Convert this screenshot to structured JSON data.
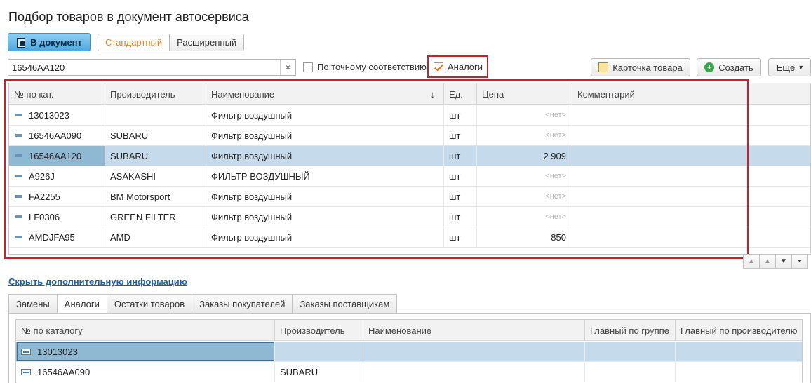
{
  "title": "Подбор товаров в документ автосервиса",
  "toolbar": {
    "to_document": "В документ",
    "mode_standard": "Стандартный",
    "mode_extended": "Расширенный",
    "card_button": "Карточка товара",
    "create_button": "Создать",
    "more_button": "Еще",
    "more_arrow": "▾"
  },
  "search": {
    "value": "16546AA120",
    "clear_symbol": "×"
  },
  "filters": {
    "exact_match": "По точному соответствию",
    "analogs": "Аналоги"
  },
  "main_table": {
    "columns": [
      "№ по кат.",
      "Производитель",
      "Наименование",
      "Ед.",
      "Цена",
      "Комментарий"
    ],
    "sort_indicator": "↓",
    "rows": [
      {
        "code": "13013023",
        "maker": "",
        "name": "Фильтр воздушный",
        "unit": "шт",
        "price": "<нет>",
        "comment": ""
      },
      {
        "code": "16546AA090",
        "maker": "SUBARU",
        "name": "Фильтр воздушный",
        "unit": "шт",
        "price": "<нет>",
        "comment": ""
      },
      {
        "code": "16546AA120",
        "maker": "SUBARU",
        "name": "Фильтр воздушный",
        "unit": "шт",
        "price": "2 909",
        "comment": ""
      },
      {
        "code": "A926J",
        "maker": "ASAKASHI",
        "name": "ФИЛЬТР ВОЗДУШНЫЙ",
        "unit": "шт",
        "price": "<нет>",
        "comment": ""
      },
      {
        "code": "FA2255",
        "maker": "BM Motorsport",
        "name": "Фильтр воздушный",
        "unit": "шт",
        "price": "<нет>",
        "comment": ""
      },
      {
        "code": "LF0306",
        "maker": "GREEN FILTER",
        "name": "Фильтр воздушный",
        "unit": "шт",
        "price": "<нет>",
        "comment": ""
      },
      {
        "code": "AMDJFA95",
        "maker": "AMD",
        "name": "Фильтр воздушный",
        "unit": "шт",
        "price": "850",
        "comment": ""
      }
    ],
    "selected_row": 2
  },
  "nav": {
    "up": "▲",
    "up2": "▲",
    "down": "▼",
    "last": "⏷"
  },
  "hide_info_link": "Скрыть дополнительную информацию",
  "tabs": [
    "Замены",
    "Аналоги",
    "Остатки товаров",
    "Заказы покупателей",
    "Заказы поставщикам"
  ],
  "active_tab": 1,
  "analog_table": {
    "columns": [
      "№ по каталогу",
      "Производитель",
      "Наименование",
      "Главный по группе",
      "Главный по производителю"
    ],
    "rows": [
      {
        "code": "13013023",
        "maker": "",
        "name": "",
        "main_group": "",
        "main_maker": ""
      },
      {
        "code": "16546AA090",
        "maker": "SUBARU",
        "name": "",
        "main_group": "",
        "main_maker": ""
      }
    ]
  }
}
